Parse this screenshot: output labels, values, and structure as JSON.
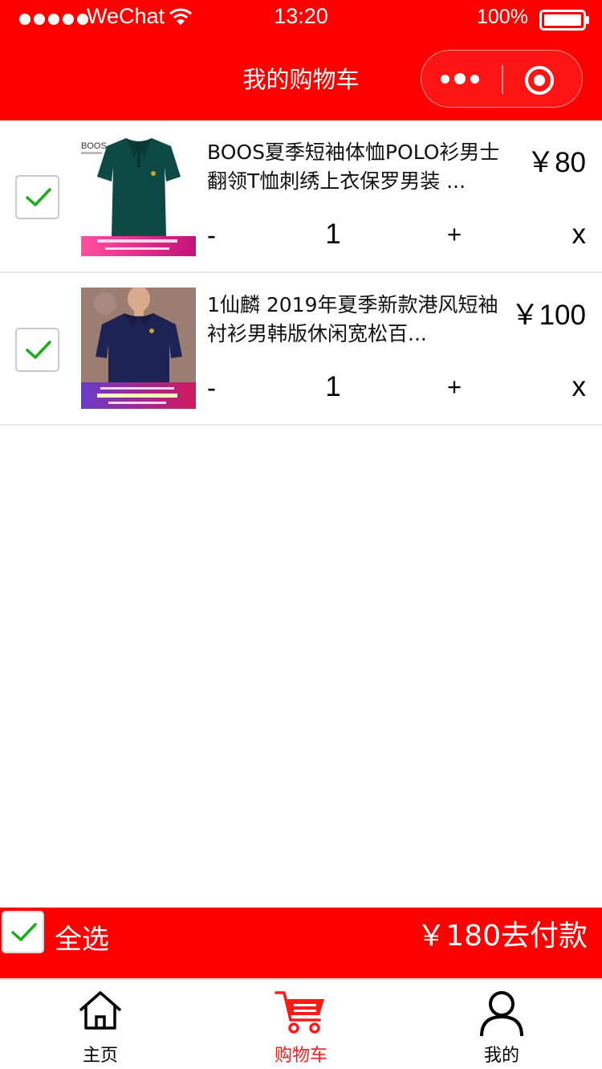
{
  "status_bar": {
    "carrier": "WeChat",
    "time": "13:20",
    "battery": "100%"
  },
  "nav": {
    "title": "我的购物车",
    "more_icon": "more-dots-icon",
    "close_icon": "record-target-icon"
  },
  "cart": {
    "items": [
      {
        "title": "BOOS夏季短袖体恤POLO衫男士翻领T恤刺绣上衣保罗男装 ...",
        "price": "￥80",
        "quantity": "1",
        "minus": "-",
        "plus": "+",
        "remove": "x",
        "checked": true
      },
      {
        "title": "1仙麟 2019年夏季新款港风短袖衬衫男韩版休闲宽松百...",
        "price": "￥100",
        "quantity": "1",
        "minus": "-",
        "plus": "+",
        "remove": "x",
        "checked": true
      }
    ]
  },
  "checkout": {
    "select_all_label": "全选",
    "total_and_pay": "￥180去付款",
    "all_checked": true
  },
  "tabbar": {
    "tabs": [
      {
        "label": "主页",
        "icon": "home-icon",
        "active": false
      },
      {
        "label": "购物车",
        "icon": "shopping-cart-icon",
        "active": true
      },
      {
        "label": "我的",
        "icon": "user-icon",
        "active": false
      }
    ]
  },
  "colors": {
    "brand_red": "#ff0000",
    "check_green": "#1aad19",
    "active_tab": "#ff1a1a"
  }
}
